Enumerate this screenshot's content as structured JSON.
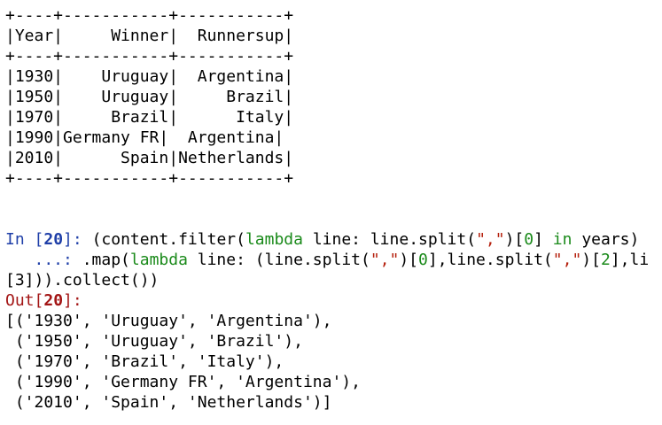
{
  "table_output": [
    "+----+-----------+-----------+",
    "|Year|     Winner|  Runnersup|",
    "+----+-----------+-----------+",
    "|1930|    Uruguay|  Argentina|",
    "|1950|    Uruguay|     Brazil|",
    "|1970|     Brazil|      Italy|",
    "|1990|Germany FR|  Argentina|",
    "|2010|      Spain|Netherlands|",
    "+----+-----------+-----------+"
  ],
  "cell": {
    "in_prompt_prefix": "In [",
    "in_prompt_number": "20",
    "in_prompt_suffix": "]: ",
    "line1": {
      "p1": "(content.filter(",
      "kw1": "lambda",
      "p2": " line: line.split(",
      "s1": "\",\"",
      "p3": ")[",
      "n1": "0",
      "p4": "] ",
      "kw2": "in",
      "p5": " years)"
    },
    "cont_prompt": "   ...: ",
    "line2": {
      "p1": ".map(",
      "kw1": "lambda",
      "p2": " line: (line.split(",
      "s1": "\",\"",
      "p3": ")[",
      "n1": "0",
      "p4": "],line.split(",
      "s2": "\",\"",
      "p5": ")[",
      "n2": "2",
      "p6": "],li"
    },
    "line3": "[3])).collect())",
    "out_prompt_prefix": "Out[",
    "out_prompt_number": "20",
    "out_prompt_suffix": "]:",
    "result": [
      "[('1930', 'Uruguay', 'Argentina'),",
      " ('1950', 'Uruguay', 'Brazil'),",
      " ('1970', 'Brazil', 'Italy'),",
      " ('1990', 'Germany FR', 'Argentina'),",
      " ('2010', 'Spain', 'Netherlands')]"
    ]
  }
}
